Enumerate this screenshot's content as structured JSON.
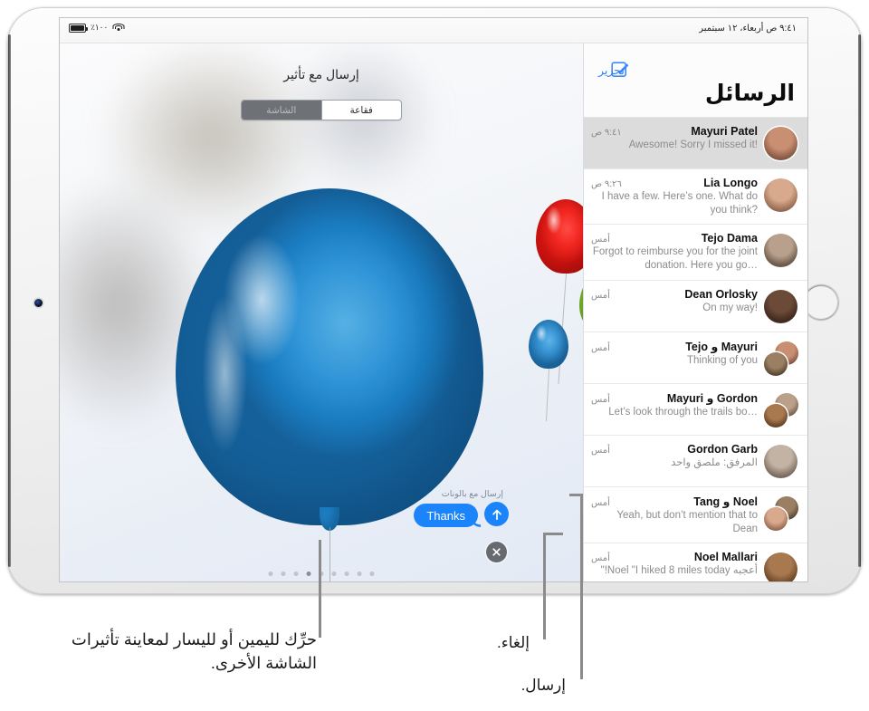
{
  "device": {
    "name": "ipad-landscape"
  },
  "status_bar": {
    "battery_percent": "٪١٠٠",
    "datetime": "٩:٤١ ص   أربعاء، ١٢ سبتمبر",
    "battery_icon": "battery-icon",
    "wifi_icon": "wifi-icon"
  },
  "messages_pane": {
    "title": "الرسائل",
    "edit_label": "تحرير",
    "compose_icon": "compose-icon",
    "conversations": [
      {
        "name": "Mayuri Patel",
        "time": "٩:٤١ ص",
        "preview": "Awesome! Sorry I missed it!",
        "rtl": false,
        "selected": true,
        "avatars": 1
      },
      {
        "name": "Lia Longo",
        "time": "٩:٢٦ ص",
        "preview": "I have a few. Here’s one. What do you think?",
        "rtl": false,
        "selected": false,
        "avatars": 1
      },
      {
        "name": "Tejo Dama",
        "time": "أمس",
        "preview": "Forgot to reimburse you for the joint donation. Here you go…",
        "rtl": false,
        "selected": false,
        "avatars": 1
      },
      {
        "name": "Dean Orlosky",
        "time": "أمس",
        "preview": "On my way!",
        "rtl": false,
        "selected": false,
        "avatars": 1
      },
      {
        "name": "Mayuri و Tejo",
        "time": "أمس",
        "preview": "Thinking of you",
        "rtl": false,
        "selected": false,
        "avatars": 2
      },
      {
        "name": "Gordon و Mayuri",
        "time": "أمس",
        "preview": "Let’s look through the trails bo…",
        "rtl": false,
        "selected": false,
        "avatars": 2
      },
      {
        "name": "Gordon Garb",
        "time": "أمس",
        "preview": "المرفق: ملصق واحد",
        "rtl": true,
        "selected": false,
        "avatars": 1
      },
      {
        "name": "Noel و Tang",
        "time": "أمس",
        "preview": "Yeah, but don’t mention that to Dean",
        "rtl": false,
        "selected": false,
        "avatars": 2
      },
      {
        "name": "Noel Mallari",
        "time": "أمس",
        "preview": "أعجبه Noel \"I hiked 8 miles today!\"",
        "rtl": true,
        "selected": false,
        "avatars": 1
      }
    ]
  },
  "effect_screen": {
    "title": "إرسال مع تأثير",
    "segments": [
      {
        "label": "فقاعة",
        "active": false
      },
      {
        "label": "الشاشة",
        "active": true
      }
    ],
    "send_with_label": "إرسال مع بالونات",
    "bubble_text": "Thanks",
    "send_icon": "up-arrow-icon",
    "cancel_icon": "close-x-icon",
    "page_dots": {
      "count": 9,
      "active_index": 3
    },
    "balloons": [
      {
        "name": "big-blue-balloon",
        "color": "#2e93d6"
      },
      {
        "name": "red-balloon",
        "color": "#f22822"
      },
      {
        "name": "green-balloon",
        "color": "#8cc83a"
      },
      {
        "name": "small-blue-balloon",
        "color": "#3a96d6"
      }
    ]
  },
  "callouts": {
    "swipe": "حرِّك لليمين أو لليسار لمعاينة تأثيرات الشاشة الأخرى.",
    "cancel": "إلغاء.",
    "send": "إرسال."
  },
  "colors": {
    "accent_blue": "#1b84fb",
    "link_blue": "#2b7cf6",
    "selected_row": "#dcdcdc",
    "cancel_gray": "#676b70"
  }
}
